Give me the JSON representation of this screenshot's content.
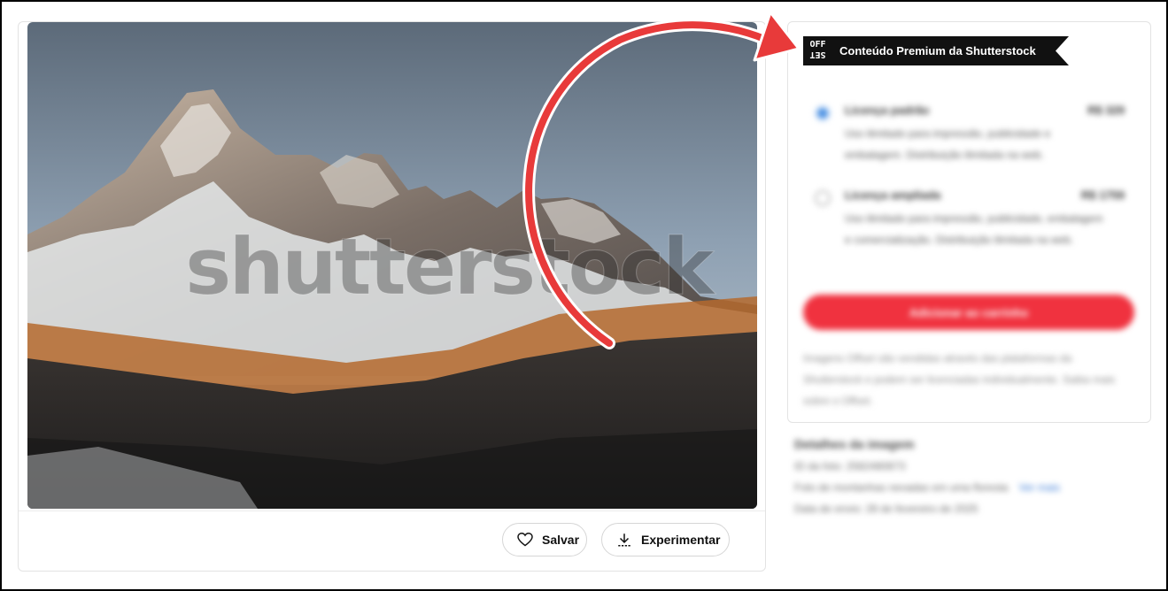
{
  "image": {
    "watermark": "shutterstock"
  },
  "actions": {
    "save_label": "Salvar",
    "try_label": "Experimentar"
  },
  "license": {
    "logo_top": "OFF",
    "logo_bottom": "SET",
    "premium_label": "Conteúdo Premium da Shutterstock",
    "options": [
      {
        "title": "Licença padrão",
        "price": "R$ 329",
        "description": "Uso ilimitado para impressão, publicidade e embalagem. Distribuição ilimitada na web.",
        "selected": true
      },
      {
        "title": "Licença ampliada",
        "price": "R$ 1759",
        "description": "Uso ilimitado para impressão, publicidade, embalagem e comercialização. Distribuição ilimitada na web.",
        "selected": false
      }
    ],
    "add_to_cart": "Adicionar ao carrinho",
    "note": "Imagens Offset são vendidas através das plataformas da Shutterstock e podem ser licenciadas individualmente. Saiba mais sobre o Offset."
  },
  "details": {
    "header": "Detalhes da imagem",
    "rows": [
      "ID da foto: 2582480873",
      "Foto de montanhas nevadas em uma floresta",
      "Data de envio: 28 de fevereiro de 2025"
    ],
    "link": "Ver mais"
  },
  "colors": {
    "accent": "#f0323f",
    "arrow": "#e83a3a",
    "radio": "#4a90e2"
  }
}
